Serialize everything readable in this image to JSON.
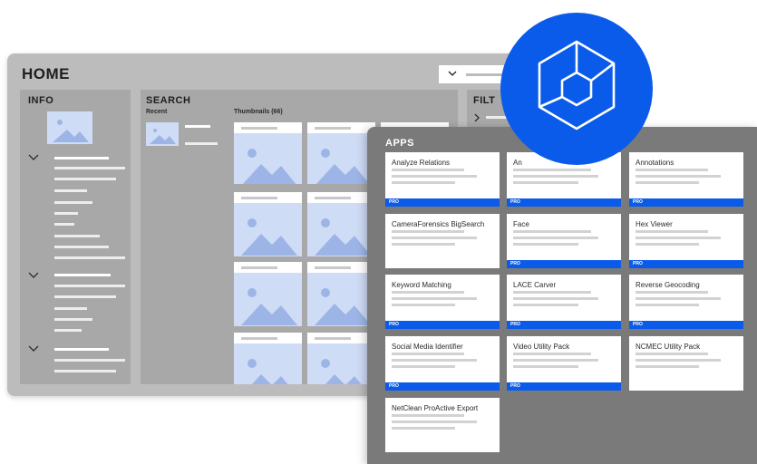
{
  "home": {
    "title": "HOME",
    "info_title": "INFO",
    "search_title": "SEARCH",
    "recent_label": "Recent",
    "thumbnails_label": "Thumbnails (66)",
    "filter_title": "FILT"
  },
  "apps": {
    "title": "APPS",
    "items": [
      {
        "name": "Analyze Relations",
        "badge": "PRO"
      },
      {
        "name": "An",
        "badge": "PRO"
      },
      {
        "name": "Annotations",
        "badge": "PRO"
      },
      {
        "name": "CameraForensics BigSearch",
        "badge": ""
      },
      {
        "name": "Face",
        "badge": "PRO"
      },
      {
        "name": "Hex Viewer",
        "badge": "PRO"
      },
      {
        "name": "Keyword Matching",
        "badge": "PRO"
      },
      {
        "name": "LACE Carver",
        "badge": "PRO"
      },
      {
        "name": "Reverse Geocoding",
        "badge": "PRO"
      },
      {
        "name": "Social Media Identifier",
        "badge": "PRO"
      },
      {
        "name": "Video Utility Pack",
        "badge": "PRO"
      },
      {
        "name": "NCMEC Utility Pack",
        "badge": ""
      },
      {
        "name": "NetClean ProActive Export",
        "badge": ""
      }
    ]
  },
  "colors": {
    "accent": "#0b5bea",
    "window_bg": "#bcbcbc",
    "panel_bg": "#a8a8a8",
    "apps_bg": "#7a7a7a",
    "placeholder": "#cfdcf6"
  },
  "icons": {
    "logo": "hexagon-cube-logo-icon",
    "chevron": "chevron-down-icon",
    "image": "image-placeholder-icon"
  }
}
